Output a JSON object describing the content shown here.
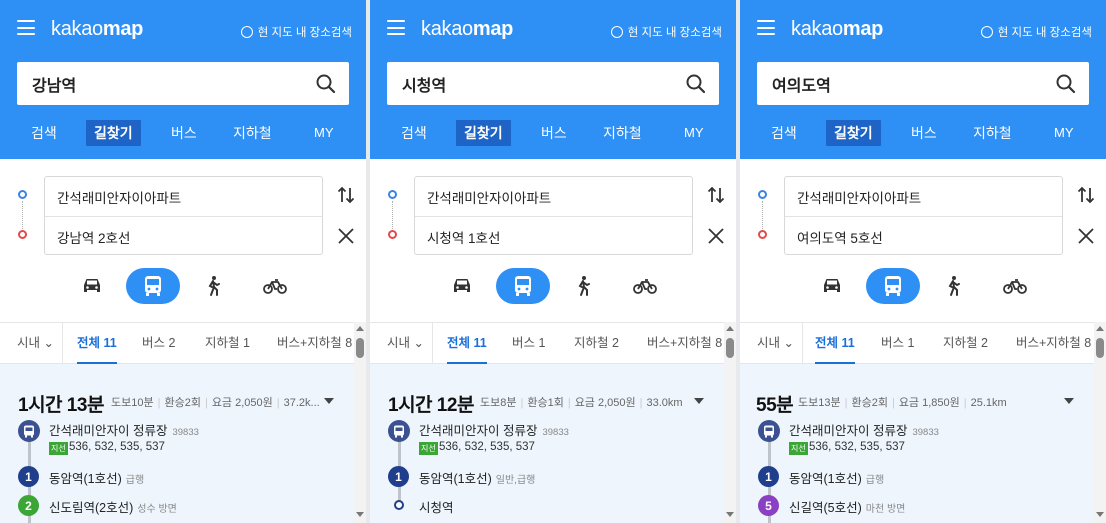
{
  "logo": {
    "light": "kakao",
    "bold": "map"
  },
  "scope_label": "현 지도 내 장소검색",
  "nav_tabs": [
    "검색",
    "길찾기",
    "버스",
    "지하철",
    "MY"
  ],
  "colors": {
    "header_blue": "#2e8ff5",
    "active_tab": "#1d64c6",
    "line1": "#1f3e8c",
    "line2": "#3ba536",
    "line5": "#8b3fc2",
    "bus": "#3c5192"
  },
  "panels": [
    {
      "search": "강남역",
      "origin": "간석래미안자이아파트",
      "destination": "강남역 2호선",
      "filters": {
        "city": "시내",
        "all": "전체 11",
        "bus": "버스 2",
        "subway": "지하철 1",
        "mixed": "버스+지하철 8"
      },
      "result": {
        "time": "1시간 13분",
        "meta": [
          "도보10분",
          "환승2회",
          "요금 2,050원",
          "37.2k..."
        ],
        "stop": "간석래미안자이 정류장",
        "stop_id": "39833",
        "bus_tag": "지선",
        "bus_numbers": "536, 532, 535, 537",
        "legs": [
          {
            "badge": "1",
            "name": "동암역(1호선)",
            "sub": "급행"
          },
          {
            "badge": "2",
            "name": "신도림역(2호선)",
            "sub": "성수 방면"
          }
        ]
      }
    },
    {
      "search": "시청역",
      "origin": "간석래미안자이아파트",
      "destination": "시청역 1호선",
      "filters": {
        "city": "시내",
        "all": "전체 11",
        "bus": "버스 1",
        "subway": "지하철 2",
        "mixed": "버스+지하철 8"
      },
      "result": {
        "time": "1시간 12분",
        "meta": [
          "도보8분",
          "환승1회",
          "요금 2,050원",
          "33.0km"
        ],
        "stop": "간석래미안자이 정류장",
        "stop_id": "39833",
        "bus_tag": "지선",
        "bus_numbers": "536, 532, 535, 537",
        "legs": [
          {
            "badge": "1",
            "name": "동암역(1호선)",
            "sub": "일반,급행"
          },
          {
            "badge": "",
            "name": "시청역",
            "sub": ""
          }
        ]
      }
    },
    {
      "search": "여의도역",
      "origin": "간석래미안자이아파트",
      "destination": "여의도역 5호선",
      "filters": {
        "city": "시내",
        "all": "전체 11",
        "bus": "버스 1",
        "subway": "지하철 2",
        "mixed": "버스+지하철 8"
      },
      "result": {
        "time": "55분",
        "meta": [
          "도보13분",
          "환승2회",
          "요금 1,850원",
          "25.1km"
        ],
        "stop": "간석래미안자이 정류장",
        "stop_id": "39833",
        "bus_tag": "지선",
        "bus_numbers": "536, 532, 535, 537",
        "legs": [
          {
            "badge": "1",
            "name": "동암역(1호선)",
            "sub": "급행"
          },
          {
            "badge": "5",
            "name": "신길역(5호선)",
            "sub": "마천 방면"
          }
        ]
      }
    }
  ]
}
